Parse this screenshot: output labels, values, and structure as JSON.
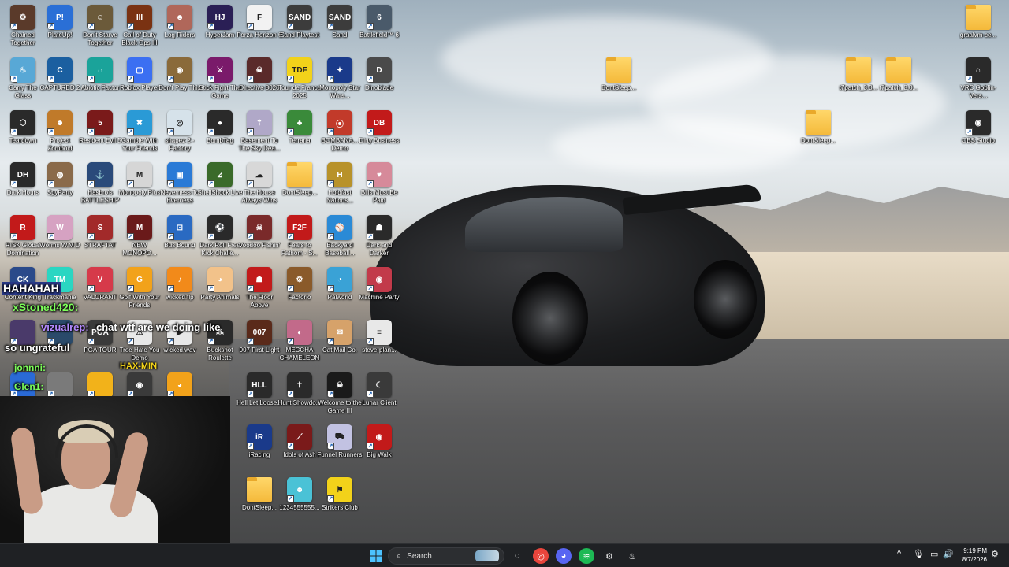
{
  "desktop": {
    "icons": [
      {
        "label": "Chained Together",
        "color": "#5a3a2a",
        "glyph": "⚙",
        "folder": false
      },
      {
        "label": "PlateUp!",
        "color": "#2a6fd6",
        "glyph": "P!",
        "folder": false
      },
      {
        "label": "Don't Starve Together",
        "color": "#6b5a3a",
        "glyph": "☺",
        "folder": false
      },
      {
        "label": "Call of Duty Black Ops III",
        "color": "#7a3212",
        "glyph": "III",
        "folder": false
      },
      {
        "label": "Log Riders",
        "color": "#b0675a",
        "glyph": "☻",
        "folder": false
      },
      {
        "label": "HyperJam",
        "color": "#2a1f55",
        "glyph": "HJ",
        "folder": false
      },
      {
        "label": "Forza Horizon 6",
        "color": "#f2f2f2",
        "glyph": "F",
        "folder": false
      },
      {
        "label": "Sand Playtest",
        "color": "#3c3c3c",
        "glyph": "SAND",
        "folder": false
      },
      {
        "label": "Sand",
        "color": "#3c3c3c",
        "glyph": "SAND",
        "folder": false
      },
      {
        "label": "Battlefield™ 6",
        "color": "#4a5a6a",
        "glyph": "6",
        "folder": false
      },
      {
        "label": "Carry The Glass",
        "color": "#58a8d6",
        "glyph": "♨",
        "folder": false
      },
      {
        "label": "CAPTURED 2",
        "color": "#1b5fa0",
        "glyph": "C",
        "folder": false
      },
      {
        "label": "Abiotic Factor",
        "color": "#1aa39a",
        "glyph": "∩",
        "folder": false
      },
      {
        "label": "Roblox Player",
        "color": "#3b6ff2",
        "glyph": "▢",
        "folder": false
      },
      {
        "label": "Don't Play This",
        "color": "#8a6a3a",
        "glyph": "◉",
        "folder": false
      },
      {
        "label": "Stick Fight The Game",
        "color": "#7a1a6a",
        "glyph": "⚔",
        "folder": false
      },
      {
        "label": "Directive 8020",
        "color": "#5a2a2a",
        "glyph": "☠",
        "folder": false
      },
      {
        "label": "Tour de France 2025",
        "color": "#f2d21a",
        "glyph": "TDF",
        "folder": false
      },
      {
        "label": "Monopoly Star Wars...",
        "color": "#1a3a8a",
        "glyph": "✦",
        "folder": false
      },
      {
        "label": "Dinoblade",
        "color": "#4a4a4a",
        "glyph": "D",
        "folder": false
      },
      {
        "label": "Teardown",
        "color": "#2a2a2a",
        "glyph": "⬡",
        "folder": false
      },
      {
        "label": "Project Zomboid",
        "color": "#c07a2a",
        "glyph": "☻",
        "folder": false
      },
      {
        "label": "Resident Evil 5",
        "color": "#7a1a1a",
        "glyph": "5",
        "folder": false
      },
      {
        "label": "Gamble With Your Friends",
        "color": "#2a9ad6",
        "glyph": "✖",
        "folder": false
      },
      {
        "label": "shapez 2 - Factory",
        "color": "#d6e2ea",
        "glyph": "◎",
        "folder": false
      },
      {
        "label": "BombTag",
        "color": "#2a2a2a",
        "glyph": "●",
        "folder": false
      },
      {
        "label": "Basement To The Sky Dea...",
        "color": "#b0a8c8",
        "glyph": "⇡",
        "folder": false
      },
      {
        "label": "Terraria",
        "color": "#3a8a3a",
        "glyph": "♣",
        "folder": false
      },
      {
        "label": "BOMBANA... Demo",
        "color": "#c23a2a",
        "glyph": "⦿",
        "folder": false
      },
      {
        "label": "Dirty Business",
        "color": "#c21a1a",
        "glyph": "DB",
        "folder": false
      },
      {
        "label": "Dark Hours",
        "color": "#2a2a2a",
        "glyph": "DH",
        "folder": false
      },
      {
        "label": "SpyParty",
        "color": "#8a6a4a",
        "glyph": "◍",
        "folder": false
      },
      {
        "label": "Hasbro's BATTLESHIP",
        "color": "#2a4a7a",
        "glyph": "⚓",
        "folder": false
      },
      {
        "label": "Monopoly Plus",
        "color": "#d6d6d6",
        "glyph": "M",
        "folder": false
      },
      {
        "label": "Neverness To Everness",
        "color": "#2a7ad6",
        "glyph": "▣",
        "folder": false
      },
      {
        "label": "ShellShock Live",
        "color": "#3a6a2a",
        "glyph": "⊿",
        "folder": false
      },
      {
        "label": "The House Always Wins",
        "color": "#d8d8d8",
        "glyph": "☁",
        "folder": false
      },
      {
        "label": "DontSleep...",
        "color": "#f4b93a",
        "glyph": "",
        "folder": true
      },
      {
        "label": "Holdfast Nations...",
        "color": "#b8922a",
        "glyph": "H",
        "folder": false
      },
      {
        "label": "Bills Must Be Paid",
        "color": "#d68a9a",
        "glyph": "♥",
        "folder": false
      },
      {
        "label": "RISK Global Domination",
        "color": "#c21a1a",
        "glyph": "R",
        "folder": false
      },
      {
        "label": "Worms W.M.D",
        "color": "#d6a2c2",
        "glyph": "W",
        "folder": false
      },
      {
        "label": "STRAFTAT",
        "color": "#a22a2a",
        "glyph": "S",
        "folder": false
      },
      {
        "label": "NEW MONOPO...",
        "color": "#6a1a1a",
        "glyph": "M",
        "folder": false
      },
      {
        "label": "Bus Bound",
        "color": "#2a6ac2",
        "glyph": "⊡",
        "folder": false
      },
      {
        "label": "Dark Roll Free Kick Challe...",
        "color": "#2a2a2a",
        "glyph": "⚽",
        "folder": false
      },
      {
        "label": "Voodoo Fishin'",
        "color": "#7a2a2a",
        "glyph": "☠",
        "folder": false
      },
      {
        "label": "Fears to Fathom - S...",
        "color": "#c21a1a",
        "glyph": "F2F",
        "folder": false
      },
      {
        "label": "Backyard Baseball...",
        "color": "#2a8ad6",
        "glyph": "⚾",
        "folder": false
      },
      {
        "label": "Dark and Darker",
        "color": "#2a2a2a",
        "glyph": "☗",
        "folder": false
      },
      {
        "label": "Content King",
        "color": "#2a4a8a",
        "glyph": "CK",
        "folder": false
      },
      {
        "label": "Trackmania",
        "color": "#2ad6c2",
        "glyph": "TM",
        "folder": false
      },
      {
        "label": "VALORANT",
        "color": "#d63a4a",
        "glyph": "V",
        "folder": false
      },
      {
        "label": "Golf With Your Friends",
        "color": "#f2a21a",
        "glyph": "G",
        "folder": false
      },
      {
        "label": "wicked.flp",
        "color": "#f28a1a",
        "glyph": "♪",
        "folder": false
      },
      {
        "label": "Party Animals",
        "color": "#f2c28a",
        "glyph": "◕",
        "folder": false
      },
      {
        "label": "The Floor Above",
        "color": "#c21a1a",
        "glyph": "☗",
        "folder": false
      },
      {
        "label": "Factorio",
        "color": "#8a5a2a",
        "glyph": "⚙",
        "folder": false
      },
      {
        "label": "Palworld",
        "color": "#3aa2d6",
        "glyph": "◔",
        "folder": false
      },
      {
        "label": "Machine Party",
        "color": "#c23a4a",
        "glyph": "◉",
        "folder": false
      },
      {
        "label": "",
        "color": "#4a3a6a",
        "glyph": "",
        "folder": false
      },
      {
        "label": "",
        "color": "#2a4a6a",
        "glyph": "",
        "folder": false
      },
      {
        "label": "PGA TOUR",
        "color": "#3a3a3a",
        "glyph": "PGA",
        "folder": false
      },
      {
        "label": "Tree Hate You Demo",
        "color": "#e8e8e8",
        "glyph": "⚠",
        "folder": false
      },
      {
        "label": "wicked.wav",
        "color": "#e8e8e8",
        "glyph": "▶",
        "folder": false
      },
      {
        "label": "Buckshot Roulette",
        "color": "#2a2a2a",
        "glyph": "⁂",
        "folder": false
      },
      {
        "label": "007 First Light",
        "color": "#5a2a1a",
        "glyph": "007",
        "folder": false
      },
      {
        "label": "MECCHA CHAMELEON",
        "color": "#c26a8a",
        "glyph": "◐",
        "folder": false
      },
      {
        "label": "Cat Mail Co.",
        "color": "#d6a26a",
        "glyph": "✉",
        "folder": false
      },
      {
        "label": "steve-plan...",
        "color": "#e8e8e8",
        "glyph": "≡",
        "folder": false
      },
      {
        "label": "",
        "color": "#2a6ad6",
        "glyph": "",
        "folder": false
      },
      {
        "label": "",
        "color": "#7a7a7a",
        "glyph": "",
        "folder": false
      },
      {
        "label": "",
        "color": "#f2b21a",
        "glyph": "",
        "folder": false
      },
      {
        "label": "",
        "color": "#3a3a3a",
        "glyph": "◉",
        "folder": false
      },
      {
        "label": "",
        "color": "#f2a21a",
        "glyph": "◕",
        "folder": false
      },
      {
        "label": "Hell Let Loose...",
        "color": "#2a2a2a",
        "glyph": "HLL",
        "folder": false
      },
      {
        "label": "Hunt Showdo...",
        "color": "#2a2a2a",
        "glyph": "✝",
        "folder": false
      },
      {
        "label": "Welcome to the Game III",
        "color": "#1a1a1a",
        "glyph": "☠",
        "folder": false
      },
      {
        "label": "Lunar Client",
        "color": "#3a3a3a",
        "glyph": "☾",
        "folder": false
      },
      {
        "label": "iRacing",
        "color": "#1a3a8a",
        "glyph": "iR",
        "folder": false
      },
      {
        "label": "Idols of Ash",
        "color": "#7a1a1a",
        "glyph": "⟋",
        "folder": false
      },
      {
        "label": "Funnel Runners",
        "color": "#c2c2e2",
        "glyph": "⛟",
        "folder": false
      },
      {
        "label": "Big Walk",
        "color": "#c21a1a",
        "glyph": "◉",
        "folder": false
      },
      {
        "label": "DontSleep...",
        "color": "#f4b93a",
        "glyph": "",
        "folder": true
      },
      {
        "label": "1234555555...",
        "color": "#4ac2d6",
        "glyph": "☻",
        "folder": false
      },
      {
        "label": "Strikers Club",
        "color": "#f2d21a",
        "glyph": "⚑",
        "folder": false
      },
      {
        "label": "DontSleep...",
        "color": "#f4b93a",
        "glyph": "",
        "folder": true
      },
      {
        "label": "t7patch_3.0...",
        "color": "#f4b93a",
        "glyph": "",
        "folder": true
      },
      {
        "label": "t7patch_3.0...",
        "color": "#f4b93a",
        "glyph": "",
        "folder": true
      },
      {
        "label": "DontSleep...",
        "color": "#f4b93a",
        "glyph": "",
        "folder": true
      },
      {
        "label": "graalvm-ce...",
        "color": "#f4b93a",
        "glyph": "",
        "folder": true
      },
      {
        "label": "VRC Goblin-Vers...",
        "color": "#2a2a2a",
        "glyph": "⌂",
        "folder": false
      },
      {
        "label": "OBS Studio",
        "color": "#2a2a2a",
        "glyph": "◉",
        "folder": false
      }
    ]
  },
  "stream_overlay": {
    "chat": [
      {
        "user": "xStoned420:",
        "text": ""
      },
      {
        "user": "vizualrep:",
        "text": "chat wtf are we doing like"
      },
      {
        "user": "",
        "text": "so ungrateful"
      },
      {
        "user": "jonnni:",
        "text": ""
      },
      {
        "user": "Glen1:",
        "text": ""
      }
    ],
    "banner_left": "HAHAHAH",
    "banner_right": "HAX-MIN"
  },
  "taskbar": {
    "search_placeholder": "Search",
    "time": "9:19 PM",
    "date": "8/7/2026",
    "apps": [
      {
        "name": "start-button",
        "glyph": "⊞",
        "color": "#4cc2ff"
      },
      {
        "name": "task-view",
        "glyph": "◌",
        "color": "#dddddd"
      },
      {
        "name": "chrome",
        "glyph": "◎",
        "color": "#e8453c"
      },
      {
        "name": "discord",
        "glyph": "◕",
        "color": "#5865f2"
      },
      {
        "name": "spotify",
        "glyph": "≋",
        "color": "#1db954"
      },
      {
        "name": "settings",
        "glyph": "⚙",
        "color": "#9aa4b0"
      },
      {
        "name": "steam",
        "glyph": "♨",
        "color": "#6ea2d6"
      }
    ],
    "tray": [
      "^",
      "🎙",
      "▭",
      "🔊"
    ]
  }
}
